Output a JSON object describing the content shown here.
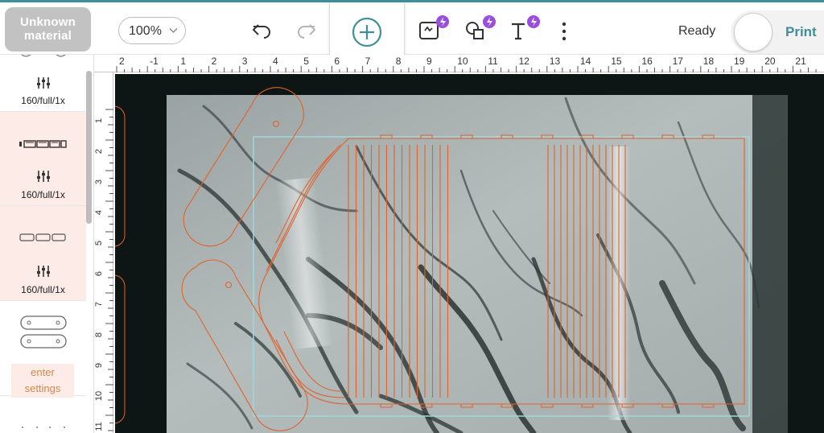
{
  "toolbar": {
    "material_line1": "Unknown",
    "material_line2": "material",
    "zoom_value": "100%",
    "status": "Ready",
    "print_label": "Print",
    "accent_color": "#3e8f99",
    "magic_badge_color": "#9b4de0"
  },
  "left_panel": {
    "items": [
      {
        "settings": "160/full/1x",
        "icon": "sliders-icon"
      },
      {
        "settings": "160/full/1x",
        "icon": "sliders-icon"
      },
      {
        "settings": "160/full/1x",
        "icon": "sliders-icon"
      }
    ],
    "enter_settings_line1": "enter",
    "enter_settings_line2": "settings"
  },
  "rulers": {
    "top_labels": [
      "2",
      "-1",
      "1",
      "2",
      "3",
      "4",
      "5",
      "6",
      "7",
      "8",
      "9",
      "10",
      "11",
      "12",
      "13",
      "14",
      "15",
      "16",
      "17",
      "18",
      "19",
      "20",
      "21"
    ],
    "left_labels": [
      "1",
      "2",
      "3",
      "4",
      "5",
      "6",
      "7",
      "8",
      "9",
      "10",
      "11"
    ]
  },
  "canvas": {
    "cut_color": "#e0622e",
    "selection_color": "#9fd8dc"
  }
}
